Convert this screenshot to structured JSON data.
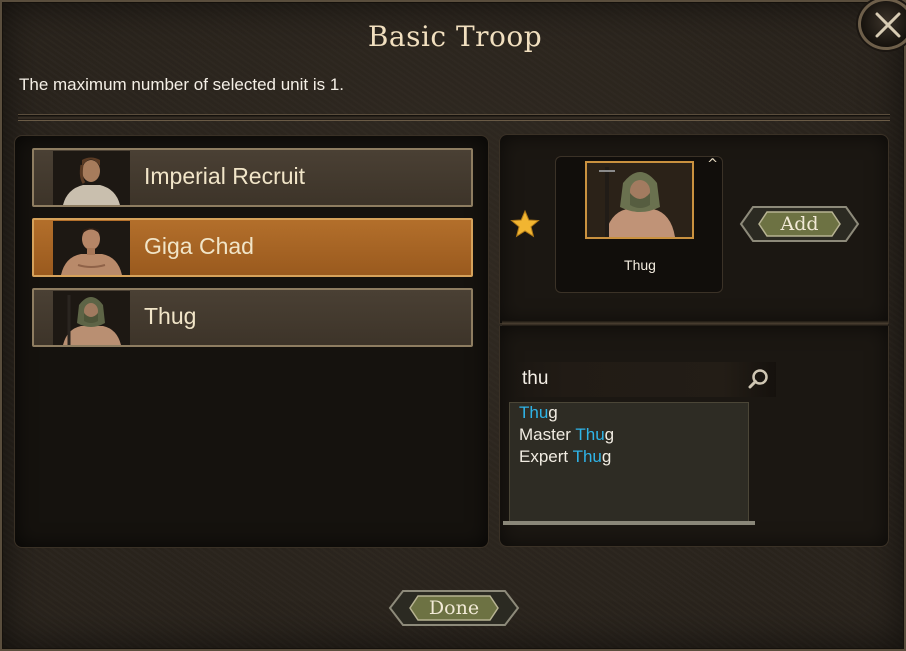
{
  "dialog": {
    "title": "Basic Troop",
    "subtitle": "The maximum number of selected unit is 1."
  },
  "troop_list": [
    {
      "name": "Imperial Recruit",
      "selected": false
    },
    {
      "name": "Giga Chad",
      "selected": true
    },
    {
      "name": "Thug",
      "selected": false
    }
  ],
  "selected_troop": {
    "name": "Thug",
    "add_label": "Add"
  },
  "search": {
    "value": "thu",
    "results": [
      {
        "match": "Thu",
        "before": "",
        "after": "g"
      },
      {
        "match": "Thu",
        "before": "Master ",
        "after": "g"
      },
      {
        "match": "Thu",
        "before": "Expert ",
        "after": "g"
      }
    ]
  },
  "footer": {
    "done_label": "Done"
  },
  "colors": {
    "accent_selected": "#b36f2b",
    "highlight": "#2fb4e8",
    "star": "#f1b531"
  },
  "icons": [
    "close-icon",
    "star-icon",
    "search-icon",
    "caret-up-icon"
  ]
}
